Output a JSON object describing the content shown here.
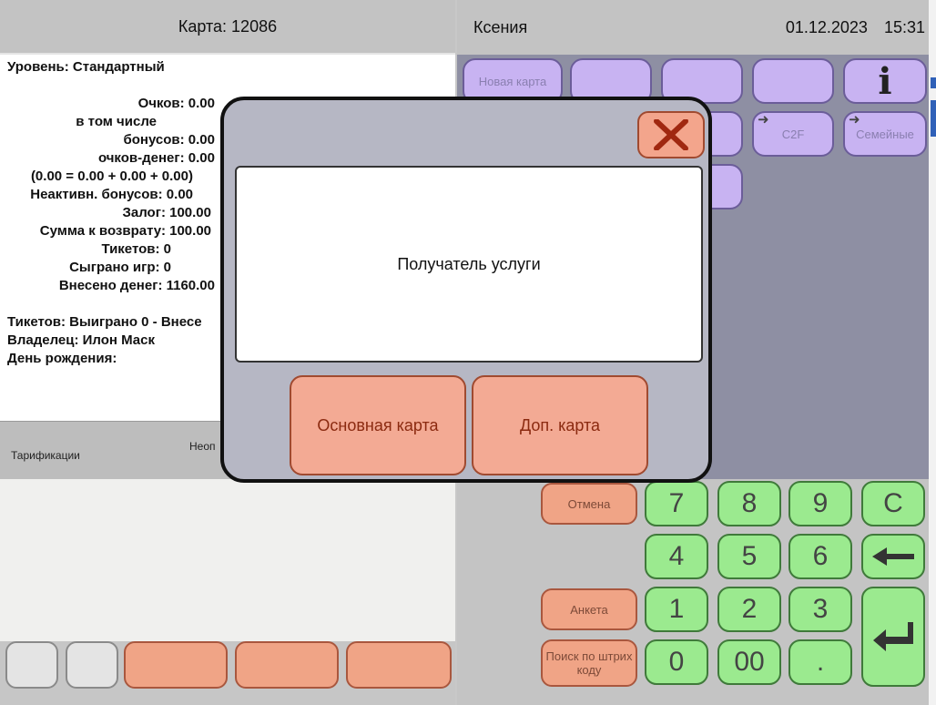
{
  "header": {
    "card": "Карта: 12086",
    "operator": "Ксения",
    "date": "01.12.2023",
    "time": "15:31"
  },
  "info": {
    "level": "Уровень: Стандартный",
    "rows": [
      "Очков: 0.00",
      "в том числе",
      "бонусов: 0.00",
      "очков-денег: 0.00",
      "(0.00 = 0.00 + 0.00 + 0.00)",
      "Неактивн. бонусов: 0.00",
      "Залог: 100.00",
      "Сумма к возврату: 100.00",
      "Тикетов: 0",
      "Сыграно игр: 0",
      "Внесено денег: 1160.00"
    ],
    "tickets": "Тикетов: Выиграно 0 - Внесе",
    "owner": "Владелец: Илон  Маск",
    "birthday": "День рождения:"
  },
  "tariff_bar": {
    "label": "Тарификации",
    "partial": "Неоп"
  },
  "right_panel": {
    "new_card": "Новая карта",
    "c2f": "C2F",
    "family": "Семейные",
    "info_icon": "info-icon"
  },
  "modal": {
    "message": "Получатель услуги",
    "main_card": "Основная карта",
    "extra_card": "Доп. карта",
    "close_icon": "close-icon"
  },
  "side_buttons": {
    "cancel": "Отмена",
    "form": "Анкета",
    "barcode": "Поиск по штрих коду"
  },
  "keypad": [
    "7",
    "8",
    "9",
    "C",
    "4",
    "5",
    "6",
    "1",
    "2",
    "3",
    "0",
    "00",
    "."
  ]
}
